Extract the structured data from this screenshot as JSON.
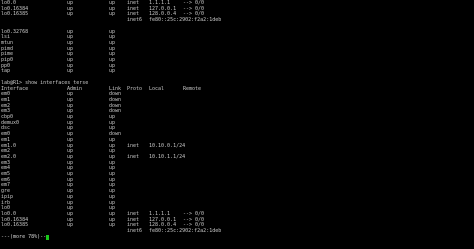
{
  "terminal": {
    "lines": [
      [
        "lo0.0",
        "up",
        "up",
        "inet",
        "1.1.1.1",
        "--> 0/0"
      ],
      [
        "lo0.16384",
        "up",
        "up",
        "inet",
        "127.0.0.1",
        "--> 0/0"
      ],
      [
        "lo0.16385",
        "up",
        "up",
        "inet",
        "128.0.0.4",
        "--> 0/0"
      ],
      [
        "",
        "",
        "",
        "inet6",
        "fe80::25c:2902:f2a2:1deb",
        ""
      ],
      [
        "",
        "",
        "",
        "",
        "",
        ""
      ],
      [
        "lo0.32768",
        "up",
        "up",
        "",
        "",
        ""
      ],
      [
        "lsi",
        "up",
        "up",
        "",
        "",
        ""
      ],
      [
        "mtun",
        "up",
        "up",
        "",
        "",
        ""
      ],
      [
        "pimd",
        "up",
        "up",
        "",
        "",
        ""
      ],
      [
        "pime",
        "up",
        "up",
        "",
        "",
        ""
      ],
      [
        "pip0",
        "up",
        "up",
        "",
        "",
        ""
      ],
      [
        "pp0",
        "up",
        "up",
        "",
        "",
        ""
      ],
      [
        "tap",
        "up",
        "up",
        "",
        "",
        ""
      ],
      [
        "",
        "",
        "",
        "",
        "",
        ""
      ],
      [
        "lab@R1> show interfaces terse",
        "",
        "",
        "",
        "",
        ""
      ],
      [
        "Interface",
        "Admin",
        "Link",
        "Proto",
        "Local",
        "Remote"
      ],
      [
        "em0",
        "up",
        "down",
        "",
        "",
        ""
      ],
      [
        "em1",
        "up",
        "down",
        "",
        "",
        ""
      ],
      [
        "em2",
        "up",
        "down",
        "",
        "",
        ""
      ],
      [
        "em3",
        "up",
        "down",
        "",
        "",
        ""
      ],
      [
        "cbp0",
        "up",
        "up",
        "",
        "",
        ""
      ],
      [
        "demux0",
        "up",
        "up",
        "",
        "",
        ""
      ],
      [
        "dsc",
        "up",
        "up",
        "",
        "",
        ""
      ],
      [
        "em0",
        "up",
        "down",
        "",
        "",
        ""
      ],
      [
        "em1",
        "up",
        "up",
        "",
        "",
        ""
      ],
      [
        "em1.0",
        "up",
        "up",
        "inet",
        "10.10.0.1/24",
        ""
      ],
      [
        "em2",
        "up",
        "up",
        "",
        "",
        ""
      ],
      [
        "em2.0",
        "up",
        "up",
        "inet",
        "10.10.1.1/24",
        ""
      ],
      [
        "em3",
        "up",
        "up",
        "",
        "",
        ""
      ],
      [
        "em4",
        "up",
        "up",
        "",
        "",
        ""
      ],
      [
        "em5",
        "up",
        "up",
        "",
        "",
        ""
      ],
      [
        "em6",
        "up",
        "up",
        "",
        "",
        ""
      ],
      [
        "em7",
        "up",
        "up",
        "",
        "",
        ""
      ],
      [
        "gre",
        "up",
        "up",
        "",
        "",
        ""
      ],
      [
        "ipip",
        "up",
        "up",
        "",
        "",
        ""
      ],
      [
        "irb",
        "up",
        "up",
        "",
        "",
        ""
      ],
      [
        "lo0",
        "up",
        "up",
        "",
        "",
        ""
      ],
      [
        "lo0.0",
        "up",
        "up",
        "inet",
        "1.1.1.1",
        "--> 0/0"
      ],
      [
        "lo0.16384",
        "up",
        "up",
        "inet",
        "127.0.0.1",
        "--> 0/0"
      ],
      [
        "lo0.16385",
        "up",
        "up",
        "inet",
        "128.0.0.4",
        "--> 0/0"
      ],
      [
        "",
        "",
        "",
        "inet6",
        "fe80::25c:2902:f2a2:1deb",
        ""
      ]
    ],
    "pager_prompt": "---(more 78%)---",
    "cursor_color": "#19c819"
  }
}
